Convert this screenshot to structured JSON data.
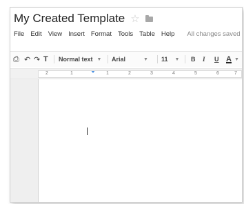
{
  "doc": {
    "title": "My Created Template",
    "star_icon": "star-icon",
    "folder_icon": "folder-icon"
  },
  "menu": {
    "items": [
      "File",
      "Edit",
      "View",
      "Insert",
      "Format",
      "Tools",
      "Table",
      "Help"
    ],
    "status": "All changes saved"
  },
  "toolbar": {
    "style": "Normal text",
    "font": "Arial",
    "size": "11",
    "bold": "B",
    "italic": "I",
    "underline": "U",
    "text_color": "A"
  },
  "ruler": {
    "labels": [
      "2",
      "1",
      "1",
      "2",
      "3",
      "4",
      "5",
      "6",
      "7",
      "8"
    ]
  }
}
